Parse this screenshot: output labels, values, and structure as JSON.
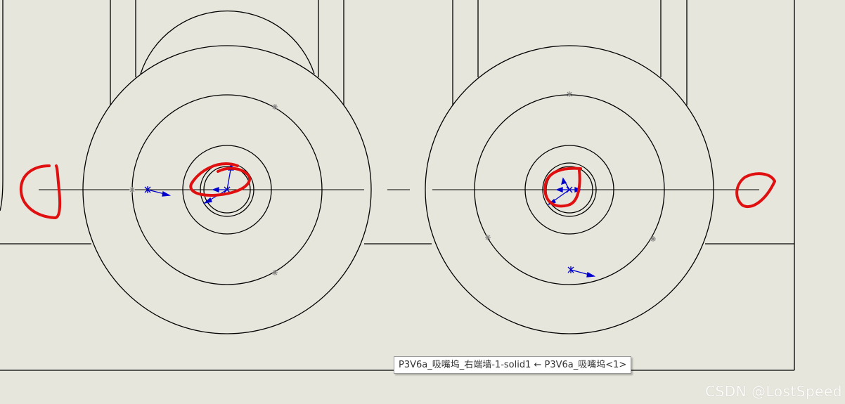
{
  "tooltip": {
    "text": "P3V6a_吸嘴坞_右端墙-1-solid1 ← P3V6a_吸嘴坞<1>"
  },
  "watermark": {
    "text": "CSDN @LostSpeed"
  },
  "colors": {
    "background": "#e7e6dc",
    "line": "#000000",
    "annotation": "#e01010",
    "triad": "#0000cc",
    "point_marker": "#808080"
  },
  "icons": [
    "origin-triad-icon",
    "coordinate-system-icon",
    "sketch-point-icon"
  ]
}
